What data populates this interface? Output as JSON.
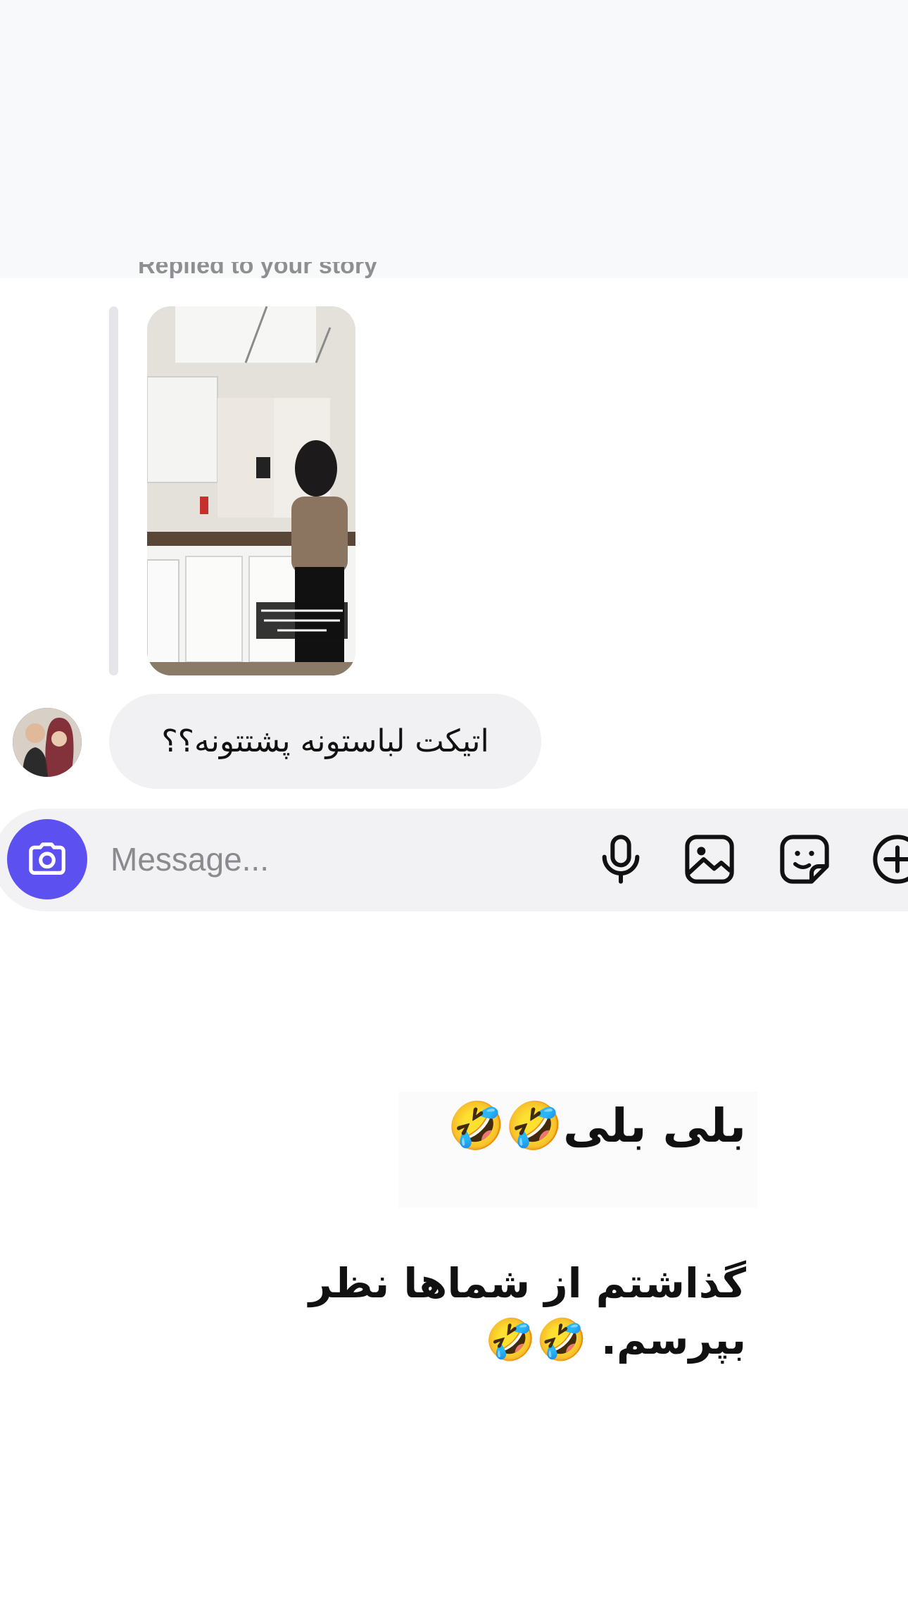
{
  "thread": {
    "replied_label": "Replied to your story",
    "story_overlay_text": "گذاشتم رو تایمر فیلم بگیره، بهو موقع خوردیم گرفت دلم نیومد قطع کنم.",
    "message_text": "اتیکت لباستونه پشتتونه؟؟"
  },
  "composer": {
    "placeholder": "Message...",
    "icons": [
      "camera-icon",
      "microphone-icon",
      "image-icon",
      "sticker-icon",
      "plus-icon"
    ],
    "accent_color": "#5c51f0"
  },
  "captions": {
    "line1": "بلی بلی🤣🤣",
    "line2": "گذاشتم از شماها نظر بپرسم. 🤣🤣"
  }
}
